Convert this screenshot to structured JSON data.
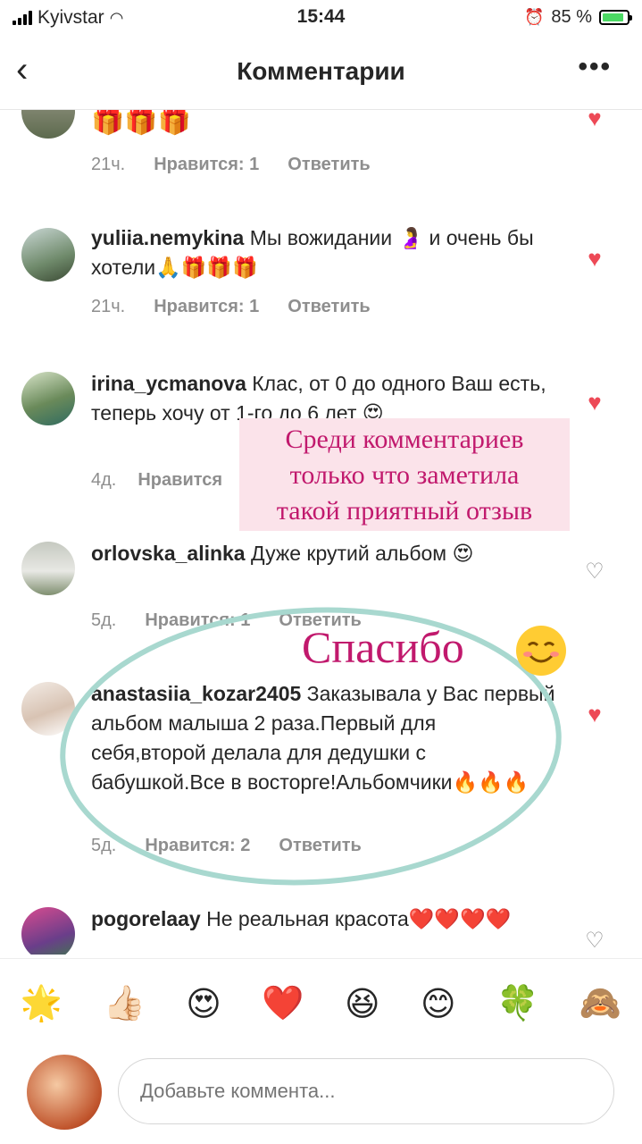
{
  "status_bar": {
    "carrier": "Kyivstar",
    "time": "15:44",
    "battery": "85 %",
    "battery_level": 0.85
  },
  "header": {
    "back": "‹",
    "title": "Комментарии",
    "more": "•••"
  },
  "comments": [
    {
      "user": "",
      "text": "🎁🎁🎁",
      "time": "21ч.",
      "likes": "Нравится: 1",
      "reply": "Ответить",
      "liked": true
    },
    {
      "user": "yuliia.nemykina",
      "text": " Мы вожидании 🤰 и очень бы хотели🙏🎁🎁🎁",
      "time": "21ч.",
      "likes": "Нравится: 1",
      "reply": "Ответить",
      "liked": true
    },
    {
      "user": "irina_ycmanova",
      "text": " Клас, от 0 до одного Ваш есть, теперь хочу от 1-го до 6 лет 😍",
      "time": "4д.",
      "likes": "Нравится",
      "reply": "",
      "liked": true
    },
    {
      "user": "orlovska_alinka",
      "text": " Дуже крутий альбом 😍",
      "time": "5д.",
      "likes": "Нравится: 1",
      "reply": "Ответить",
      "liked": false
    },
    {
      "user": "anastasiia_kozar2405",
      "text": " Заказывала у Вас первый альбом малыша 2 раза.Первый для себя,второй делала для дедушки с бабушкой.Все в восторге!Альбомчики🔥🔥🔥",
      "time": "5д.",
      "likes": "Нравится: 2",
      "reply": "Ответить",
      "liked": true
    },
    {
      "user": "pogorelaay",
      "text": " Не реальная красота❤️❤️❤️❤️",
      "time": "",
      "likes": "",
      "reply": "",
      "liked": false
    }
  ],
  "overlay": {
    "note_lines": [
      "Среди комментариев",
      "только что заметила",
      "такой приятный отзыв"
    ],
    "thanks": "Спасибо"
  },
  "emoji_bar": [
    "🌟",
    "👍🏻",
    "😍",
    "❤️",
    "😆",
    "😊",
    "🍀",
    "🙈"
  ],
  "composer": {
    "placeholder": "Добавьте коммента..."
  },
  "icons": {
    "heart_liked": "heart-filled-icon",
    "heart_unliked": "heart-outline-icon"
  },
  "colors": {
    "like": "#ed4956",
    "accent_pink": "#c1196d",
    "ring": "#a8d8cf"
  }
}
